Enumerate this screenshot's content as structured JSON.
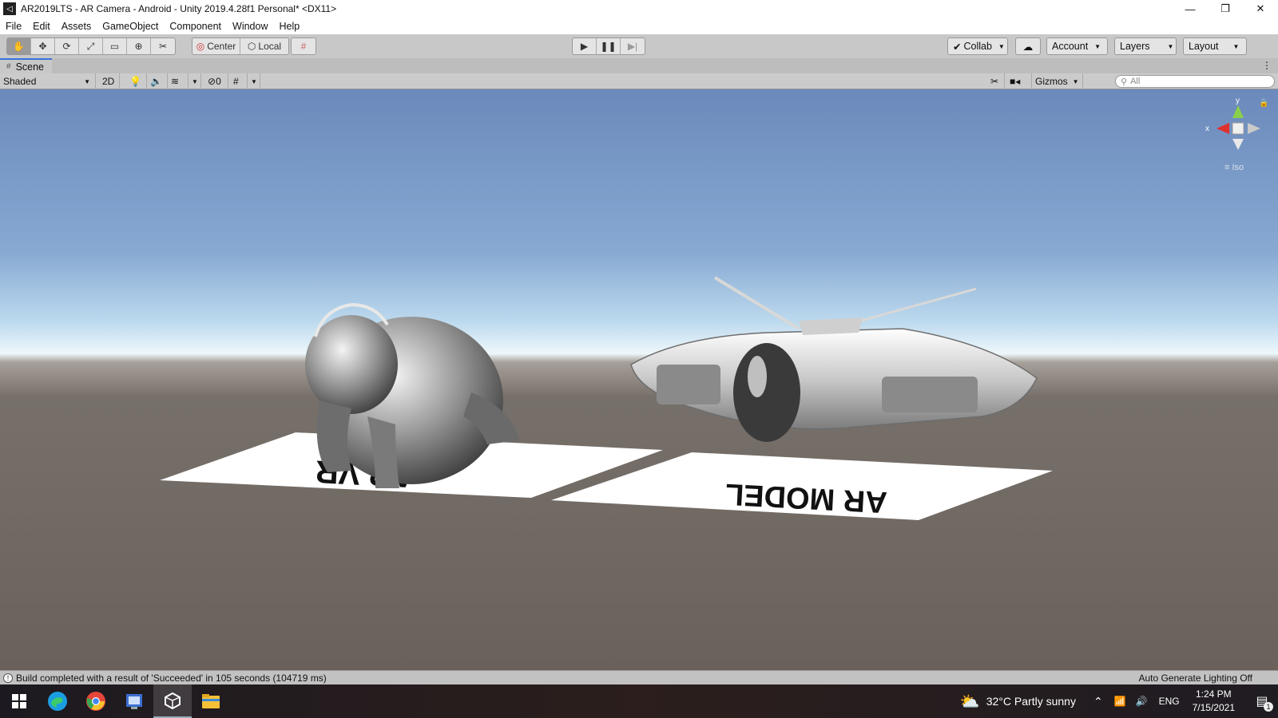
{
  "window": {
    "title": "AR2019LTS - AR Camera - Android - Unity 2019.4.28f1 Personal* <DX11>",
    "controls": [
      "—",
      "❐",
      "✕"
    ]
  },
  "menu": [
    "File",
    "Edit",
    "Assets",
    "GameObject",
    "Component",
    "Window",
    "Help"
  ],
  "toolbar": {
    "pivot_center": "Center",
    "pivot_local": "Local",
    "collab": "Collab",
    "account": "Account",
    "layers": "Layers",
    "layout": "Layout"
  },
  "scene_tab": {
    "label": "Scene"
  },
  "scene_toolbar": {
    "draw_mode": "Shaded",
    "mode_2d": "2D",
    "hidden_count": "0",
    "gizmos": "Gizmos",
    "search_placeholder": "All"
  },
  "gizmo": {
    "x": "x",
    "y": "y",
    "projection": "Iso"
  },
  "markers": {
    "left": "AR VR",
    "right": "AR MODEL"
  },
  "status": {
    "message": "Build completed with a result of 'Succeeded' in 105 seconds (104719 ms)",
    "right": "Auto Generate Lighting Off"
  },
  "taskbar": {
    "weather": "32°C  Partly sunny",
    "lang": "ENG",
    "time": "1:24 PM",
    "date": "7/15/2021",
    "notification_count": "1"
  },
  "colors": {
    "sky_top": "#6e8cbd",
    "sky_horizon": "#e8f4fb",
    "ground": "#6c625b",
    "accent_tab": "#3a72d8"
  }
}
